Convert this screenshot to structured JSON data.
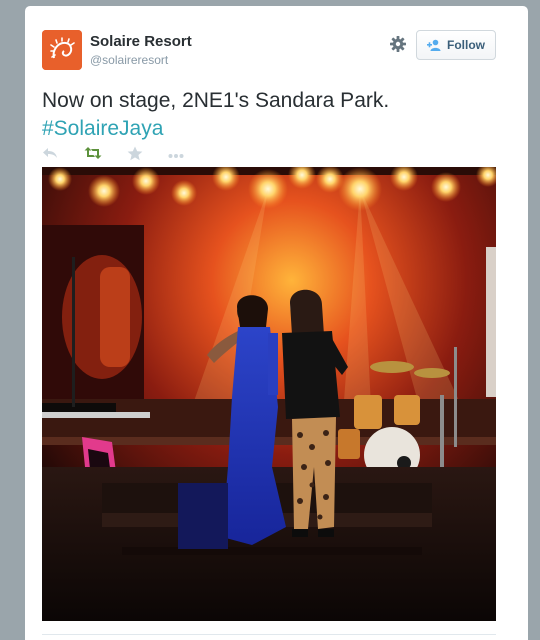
{
  "tweet": {
    "author_name": "Solaire Resort",
    "author_handle": "@solaireresort",
    "follow_label": "Follow",
    "text_main": "Now on stage, 2NE1's Sandara Park.",
    "hashtag": "#SolaireJaya"
  },
  "icons": {
    "avatar": "solaire-logo",
    "settings": "gear-icon",
    "follow": "add-user-icon",
    "reply": "reply-icon",
    "retweet": "retweet-icon",
    "favorite": "star-icon",
    "more": "more-dots-icon"
  },
  "colors": {
    "brand": "#e8602b",
    "hashtag": "#2fa3b4",
    "retweet_active": "#5c913b",
    "text": "#292f33",
    "muted": "#8899a6"
  },
  "photo": {
    "subject": "photo"
  }
}
